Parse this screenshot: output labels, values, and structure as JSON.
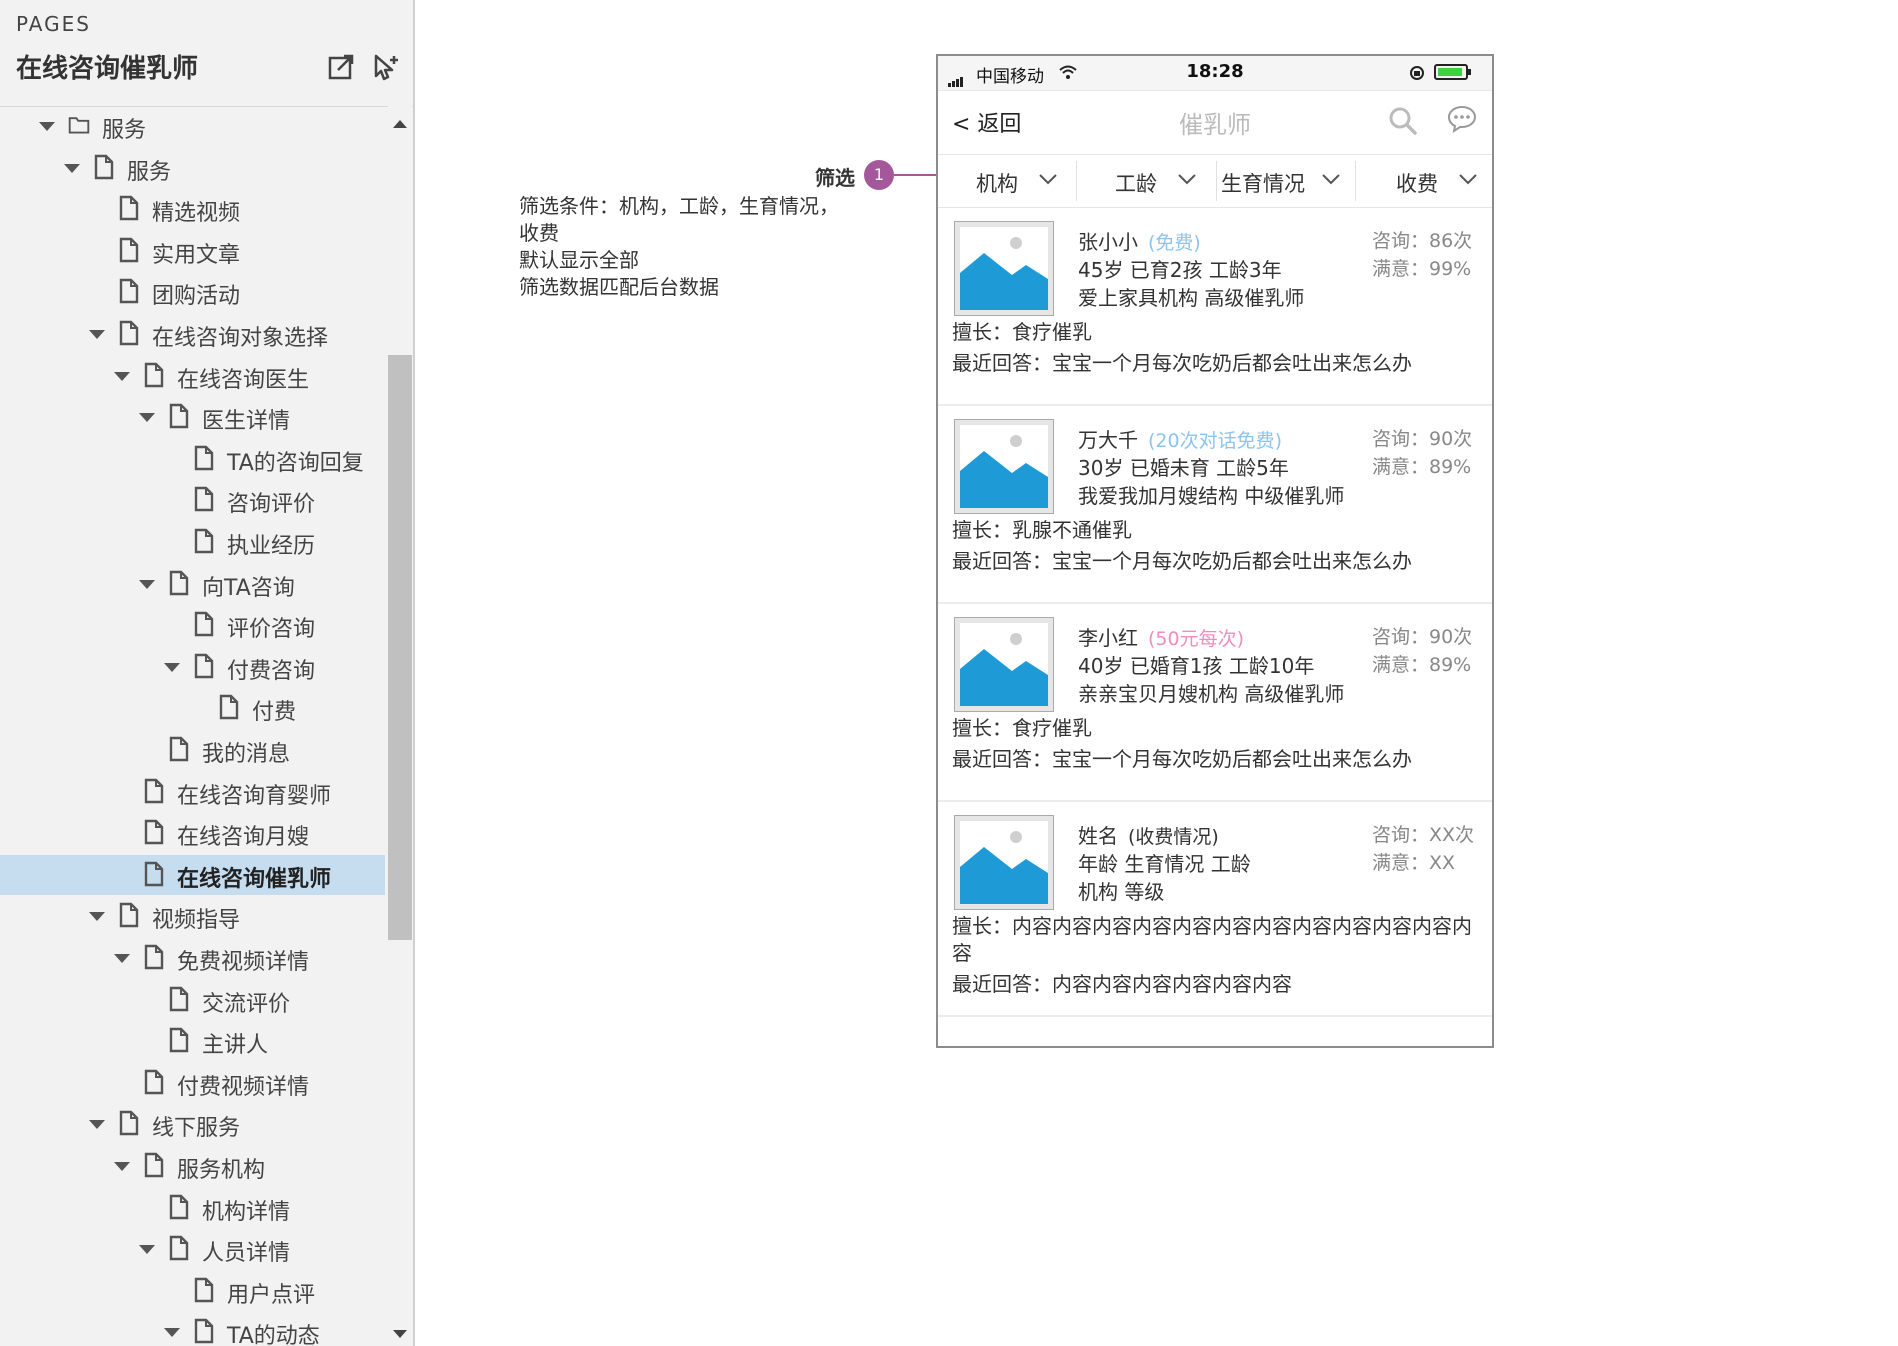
{
  "sidebar": {
    "pages_label": "PAGES",
    "title": "在线咨询催乳师",
    "tree": [
      {
        "label": "服务",
        "level": 0,
        "icon": "folder",
        "expanded": true
      },
      {
        "label": "服务",
        "level": 1,
        "icon": "page",
        "expanded": true
      },
      {
        "label": "精选视频",
        "level": 2,
        "icon": "page"
      },
      {
        "label": "实用文章",
        "level": 2,
        "icon": "page"
      },
      {
        "label": "团购活动",
        "level": 2,
        "icon": "page"
      },
      {
        "label": "在线咨询对象选择",
        "level": 2,
        "icon": "page",
        "expanded": true
      },
      {
        "label": "在线咨询医生",
        "level": 3,
        "icon": "page",
        "expanded": true
      },
      {
        "label": "医生详情",
        "level": 4,
        "icon": "page",
        "expanded": true
      },
      {
        "label": "TA的咨询回复",
        "level": 5,
        "icon": "page"
      },
      {
        "label": "咨询评价",
        "level": 5,
        "icon": "page"
      },
      {
        "label": "执业经历",
        "level": 5,
        "icon": "page"
      },
      {
        "label": "向TA咨询",
        "level": 4,
        "icon": "page",
        "expanded": true
      },
      {
        "label": "评价咨询",
        "level": 5,
        "icon": "page"
      },
      {
        "label": "付费咨询",
        "level": 5,
        "icon": "page",
        "expanded": true
      },
      {
        "label": "付费",
        "level": 6,
        "icon": "page"
      },
      {
        "label": "我的消息",
        "level": 4,
        "icon": "page"
      },
      {
        "label": "在线咨询育婴师",
        "level": 3,
        "icon": "page"
      },
      {
        "label": "在线咨询月嫂",
        "level": 3,
        "icon": "page"
      },
      {
        "label": "在线咨询催乳师",
        "level": 3,
        "icon": "page",
        "selected": true
      },
      {
        "label": "视频指导",
        "level": 2,
        "icon": "page",
        "expanded": true
      },
      {
        "label": "免费视频详情",
        "level": 3,
        "icon": "page",
        "expanded": true
      },
      {
        "label": "交流评价",
        "level": 4,
        "icon": "page"
      },
      {
        "label": "主讲人",
        "level": 4,
        "icon": "page"
      },
      {
        "label": "付费视频详情",
        "level": 3,
        "icon": "page"
      },
      {
        "label": "线下服务",
        "level": 2,
        "icon": "page",
        "expanded": true
      },
      {
        "label": "服务机构",
        "level": 3,
        "icon": "page",
        "expanded": true
      },
      {
        "label": "机构详情",
        "level": 4,
        "icon": "page"
      },
      {
        "label": "人员详情",
        "level": 4,
        "icon": "page",
        "expanded": true
      },
      {
        "label": "用户点评",
        "level": 5,
        "icon": "page"
      },
      {
        "label": "TA的动态",
        "level": 5,
        "icon": "page",
        "expanded": true
      }
    ]
  },
  "annotation": {
    "label": "筛选",
    "badge": "1",
    "notes": [
      "筛选条件：机构，工龄，生育情况，",
      "收费",
      "默认显示全部",
      "筛选数据匹配后台数据"
    ]
  },
  "phone": {
    "carrier": "中国移动",
    "time": "18:28",
    "back_label": "< 返回",
    "title": "催乳师",
    "filters": [
      "机构",
      "工龄",
      "生育情况",
      "收费"
    ],
    "cards": [
      {
        "name": "张小小",
        "price": "(免费)",
        "price_color": "#8cc4ee",
        "line2": "45岁  已育2孩   工龄3年",
        "line3": "爱上家具机构 高级催乳师",
        "consult": "咨询：86次",
        "satisfaction": "满意：99%",
        "specialty": "擅长：食疗催乳",
        "recent_answer": "最近回答：宝宝一个月每次吃奶后都会吐出来怎么办"
      },
      {
        "name": "万大千",
        "price": "(20次对话免费)",
        "price_color": "#8cc4ee",
        "line2": "30岁  已婚未育  工龄5年",
        "line3": "我爱我加月嫂结构  中级催乳师",
        "consult": "咨询：90次",
        "satisfaction": "满意：89%",
        "specialty": "擅长：乳腺不通催乳",
        "recent_answer": "最近回答：宝宝一个月每次吃奶后都会吐出来怎么办"
      },
      {
        "name": "李小红",
        "price": "(50元每次)",
        "price_color": "#f08cc0",
        "line2": "40岁 已婚育1孩  工龄10年",
        "line3": "亲亲宝贝月嫂机构  高级催乳师",
        "consult": "咨询：90次",
        "satisfaction": "满意：89%",
        "specialty": "擅长：食疗催乳",
        "recent_answer": "最近回答：宝宝一个月每次吃奶后都会吐出来怎么办"
      },
      {
        "name": "姓名",
        "price": "(收费情况)",
        "price_color": "#333333",
        "line2": "年龄  生育情况  工龄",
        "line3": "机构 等级",
        "consult": "咨询：XX次",
        "satisfaction": "满意：XX",
        "specialty": "擅长：内容内容内容内容内容内容内容内容内容内容内容内容",
        "recent_answer": "最近回答：内容内容内容内容内容内容"
      }
    ]
  },
  "colors": {
    "accent_badge": "#a4589b",
    "image_blue": "#1e9ad6",
    "selected_row": "#c5ddef"
  }
}
